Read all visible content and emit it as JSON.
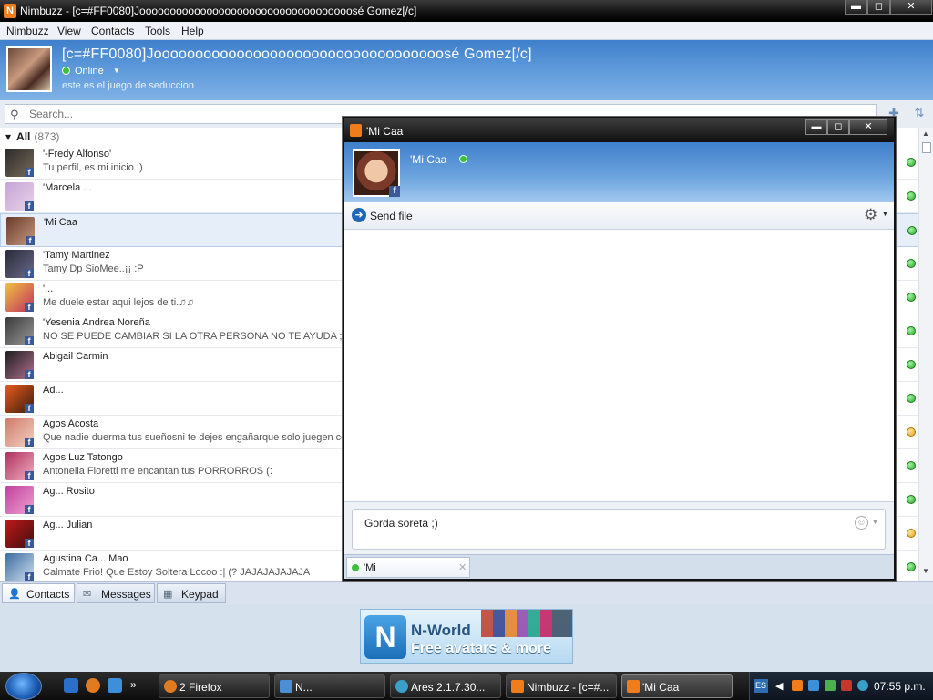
{
  "window": {
    "title": "Nimbuzz - [c=#FF0080]Jooooooooooooooooooooooooooooooooooosé Gomez[/c]",
    "min": "▬",
    "max": "◻",
    "close": "✕"
  },
  "menu": [
    "Nimbuzz",
    "View",
    "Contacts",
    "Tools",
    "Help"
  ],
  "profile": {
    "name": "[c=#FF0080]Jooooooooooooooooooooooooooooooooooosé Gomez[/c]",
    "status": "Online",
    "mood": "este es el juego de seduccion"
  },
  "search": {
    "placeholder": "Search..."
  },
  "group": {
    "label": "All",
    "count": "(873)"
  },
  "contacts": [
    {
      "name": "'-Fredy Alfonso'",
      "msg": "Tu perfil, es mi inicio :)",
      "status": "online"
    },
    {
      "name": "'Marcela ...",
      "msg": "",
      "status": "online"
    },
    {
      "name": "'Mi Caa",
      "msg": "",
      "status": "online",
      "selected": true
    },
    {
      "name": "'Tamy Martinez",
      "msg": "Tamy Dp SioMee..¡¡ :P",
      "status": "online"
    },
    {
      "name": "'...",
      "msg": "Me duele estar aqui lejos de ti.♫♫",
      "status": "online"
    },
    {
      "name": "'Yesenia Andrea Noreña",
      "msg": "NO SE PUEDE CAMBIAR SI LA OTRA PERSONA NO TE AYUDA ;)",
      "status": "online"
    },
    {
      "name": "Abigail Carmin",
      "msg": "",
      "status": "online"
    },
    {
      "name": "Ad...",
      "msg": "",
      "status": "online"
    },
    {
      "name": "Agos Acosta",
      "msg": "Que nadie duerma tus sueñosni te dejes engañarque solo juegen con",
      "status": "away"
    },
    {
      "name": "Agos Luz Tatongo",
      "msg": "Antonella Fioretti me encantan tus PORRORROS (:",
      "status": "online"
    },
    {
      "name": "Ag... Rosito",
      "msg": "",
      "status": "online"
    },
    {
      "name": "Ag... Julian",
      "msg": "",
      "status": "away"
    },
    {
      "name": "Agustina Ca... Mao",
      "msg": "Calmate Frio! Que Estoy Soltera Locoo :| (? JAJAJAJAJAJA",
      "status": "online"
    }
  ],
  "tabs": [
    "Contacts",
    "Messages",
    "Keypad"
  ],
  "ad": {
    "title": "N-World",
    "subtitle": "Free avatars & more",
    "logo": "N"
  },
  "taskbar": {
    "items": [
      "2 Firefox",
      "N...",
      "Ares 2.1.7.30...",
      "Nimbuzz - [c=#...",
      "'Mi Caa"
    ],
    "lang": "ES",
    "clock": "07:55 p.m."
  },
  "chat": {
    "title": "'Mi Caa",
    "contact_name": "'Mi Caa",
    "send_file": "Send file",
    "input_value": "Gorda soreta ;)",
    "tab_label": "'Mi",
    "tab_close": "✕"
  },
  "colors": {
    "accent": "#3f7fcb",
    "online": "#3cc13c",
    "away": "#e6a11a",
    "brand": "#f07d1a",
    "facebook": "#3b5998"
  }
}
